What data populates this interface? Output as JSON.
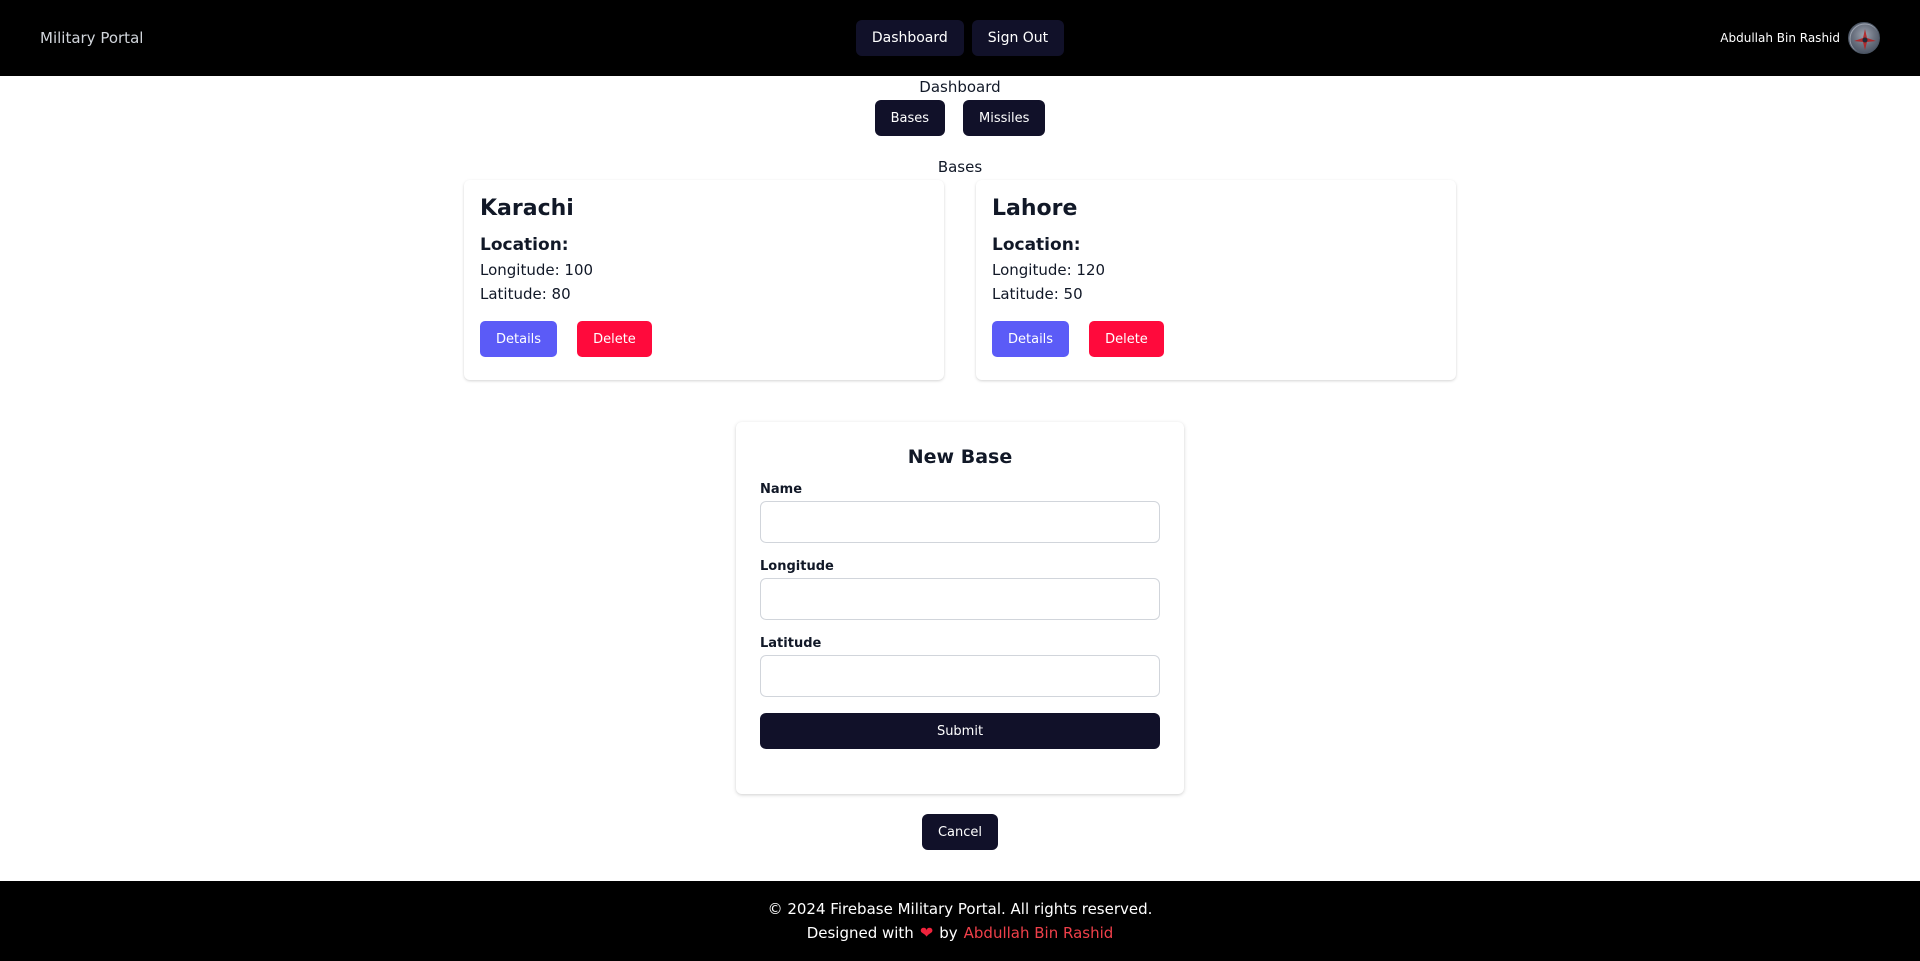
{
  "header": {
    "brand": "Military Portal",
    "nav": {
      "dashboard": "Dashboard",
      "sign_out": "Sign Out"
    },
    "user_name": "Abdullah Bin Rashid"
  },
  "dashboard": {
    "title": "Dashboard",
    "tabs": {
      "bases": "Bases",
      "missiles": "Missiles"
    }
  },
  "bases": {
    "section_title": "Bases",
    "items": [
      {
        "name": "Karachi",
        "location_label": "Location:",
        "longitude": "Longitude: 100",
        "latitude": "Latitude: 80",
        "details": "Details",
        "delete": "Delete"
      },
      {
        "name": "Lahore",
        "location_label": "Location:",
        "longitude": "Longitude: 120",
        "latitude": "Latitude: 50",
        "details": "Details",
        "delete": "Delete"
      }
    ]
  },
  "form": {
    "title": "New Base",
    "name_label": "Name",
    "name_value": "",
    "longitude_label": "Longitude",
    "longitude_value": "",
    "latitude_label": "Latitude",
    "latitude_value": "",
    "submit": "Submit",
    "cancel": "Cancel"
  },
  "footer": {
    "copyright": "© 2024 Firebase Military Portal. All rights reserved.",
    "designed_with": "Designed with",
    "heart_icon": "heart-icon",
    "by": "by",
    "author": "Abdullah Bin Rashid"
  },
  "colors": {
    "nav_bg": "#000000",
    "button_dark": "#111129",
    "details": "#5b5bf7",
    "delete": "#ff0a3c",
    "link": "#f0404a"
  }
}
